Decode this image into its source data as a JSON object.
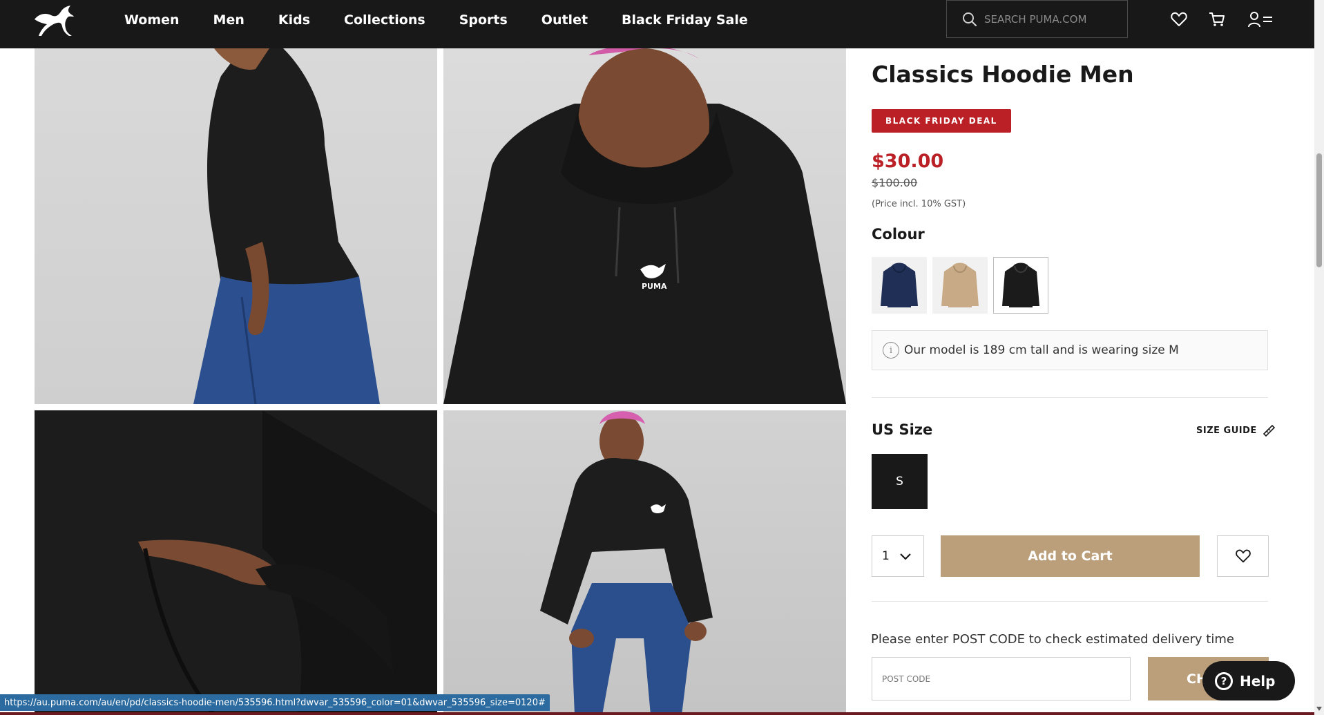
{
  "header": {
    "nav": [
      "Women",
      "Men",
      "Kids",
      "Collections",
      "Sports",
      "Outlet",
      "Black Friday Sale"
    ],
    "search_placeholder": "SEARCH PUMA.COM",
    "icons": [
      "wishlist-heart-icon",
      "cart-icon",
      "account-menu-icon"
    ]
  },
  "gallery": {
    "images": [
      "hoodie-side-view",
      "hoodie-front-closeup",
      "hoodie-pocket-detail",
      "hoodie-full-body"
    ]
  },
  "product": {
    "title": "Classics Hoodie Men",
    "badge": "BLACK FRIDAY DEAL",
    "price_sale": "$30.00",
    "price_original": "$100.00",
    "price_note": "(Price incl. 10% GST)",
    "colour_label": "Colour",
    "colours": [
      {
        "name": "navy",
        "hex": "#1f2f55"
      },
      {
        "name": "beige",
        "hex": "#c8ab86"
      },
      {
        "name": "black",
        "hex": "#1b1b1b",
        "selected": true
      }
    ],
    "model_info": "Our model is 189 cm tall and is wearing size M",
    "size_label": "US Size",
    "size_guide": "SIZE GUIDE",
    "sizes": [
      "S"
    ],
    "quantity": "1",
    "add_to_cart": "Add to Cart",
    "postcode_prompt": "Please enter POST CODE to check estimated delivery time",
    "postcode_placeholder": "POST CODE",
    "check_button": "CH"
  },
  "help": {
    "label": "Help"
  },
  "status_bar": {
    "url": "https://au.puma.com/au/en/pd/classics-hoodie-men/535596.html?dwvar_535596_color=01&dwvar_535596_size=0120#"
  },
  "colors": {
    "header_bg": "#181818",
    "sale_red": "#ba2025",
    "accent_tan": "#ba9f7a"
  }
}
